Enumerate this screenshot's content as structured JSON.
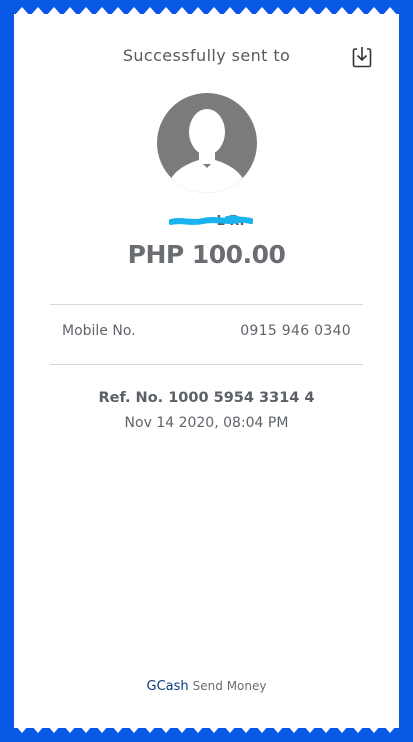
{
  "header": {
    "title": "Successfully sent to",
    "download_icon": "download-icon"
  },
  "recipient": {
    "avatar_icon": "user-avatar-icon",
    "name_visible": "L R."
  },
  "amount": "PHP 100.00",
  "details": {
    "mobile_label": "Mobile No.",
    "mobile_value": "0915 946 0340"
  },
  "reference": {
    "ref_no": "Ref. No. 1000 5954 3314 4",
    "datetime": "Nov 14 2020, 08:04 PM"
  },
  "footer": {
    "brand": "GCash",
    "service": "Send Money"
  },
  "colors": {
    "background": "#0a58e6",
    "receipt": "#ffffff",
    "brand": "#0a3c7a",
    "redaction": "#19b4f0"
  }
}
